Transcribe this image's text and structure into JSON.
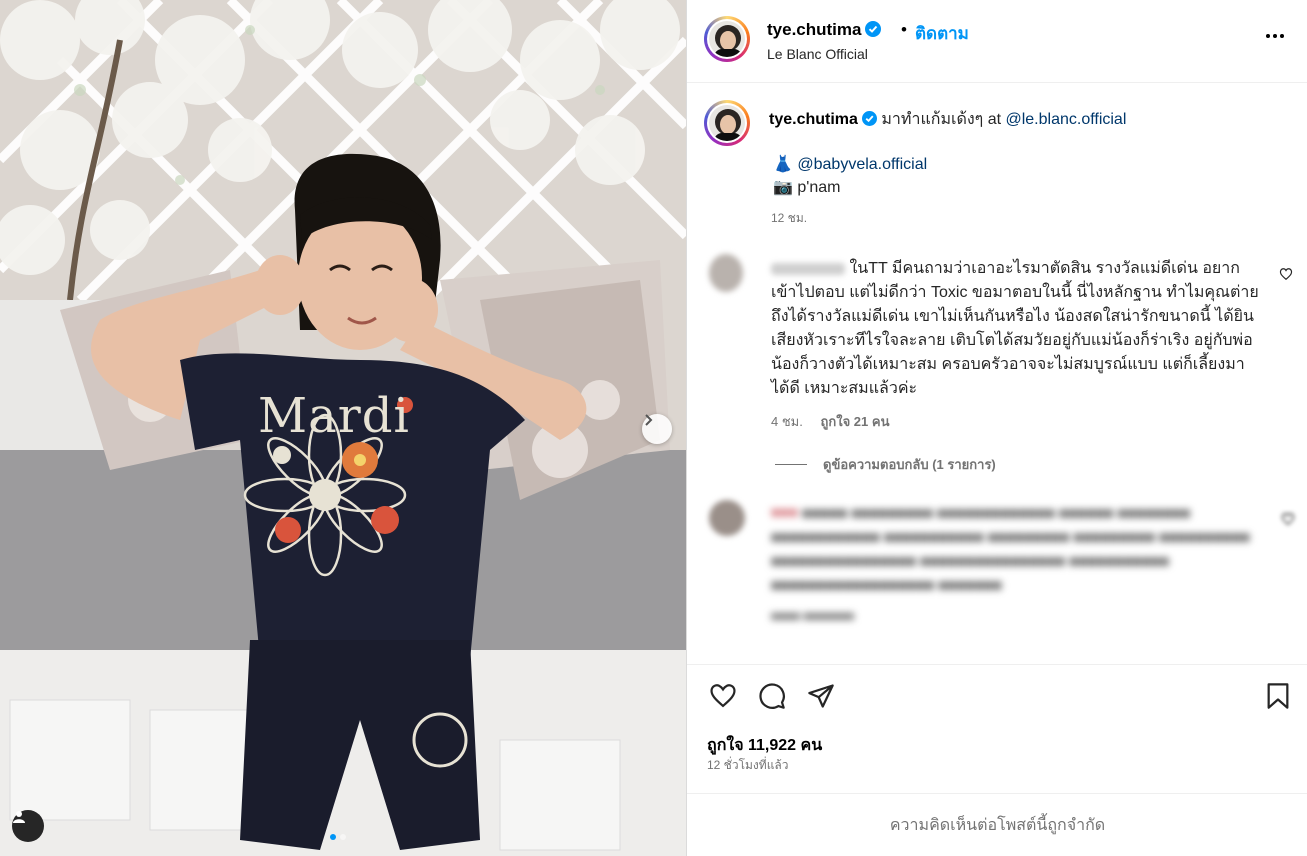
{
  "media": {
    "shirt_text": "Mardi",
    "carousel_count": 2,
    "carousel_index": 1
  },
  "header": {
    "username": "tye.chutima",
    "separator": "•",
    "follow_label": "ติดตาม",
    "location": "Le Blanc Official"
  },
  "caption": {
    "username": "tye.chutima",
    "text": "มาทำแก้มเด้งๆ at ",
    "mention": "@le.blanc.official",
    "line2_emoji": "👗",
    "line2_mention": "@babyvela.official",
    "line3_emoji": "📷",
    "line3_text": "p'nam",
    "time": "12 ชม."
  },
  "comment1": {
    "text": "ในTT มีคนถามว่าเอาอะไรมาตัดสิน รางวัลแม่ดีเด่น อยากเข้าไปตอบ แต่ไม่ดีกว่า Toxic ขอมาตอบในนี้ นี่ไงหลักฐาน ทำไมคุณต่ายถึงได้รางวัลแม่ดีเด่น เขาไม่เห็นกันหรือไง น้องสดใสน่ารักขนาดนี้ ได้ยินเสียงหัวเราะทีไรใจละลาย เติบโตได้สมวัยอยู่กับแม่น้องก็ร่าเริง อยู่กับพ่อน้องก็วางตัวได้เหมาะสม ครอบครัวอาจจะไม่สมบูรณ์แบบ แต่ก็เลี้ยงมาได้ดี เหมาะสมแล้วค่ะ",
    "time": "4 ชม.",
    "likes": "ถูกใจ 21 คน",
    "replies_label": "ดูข้อความตอบกลับ (1 รายการ)"
  },
  "actions": {
    "likes": "ถูกใจ 11,922 คน",
    "time_ago": "12 ชั่วโมงที่แล้ว",
    "limited": "ความคิดเห็นต่อโพสต์นี้ถูกจำกัด"
  },
  "colors": {
    "accent": "#0095f6",
    "link": "#00376b",
    "secondary": "#737373"
  }
}
